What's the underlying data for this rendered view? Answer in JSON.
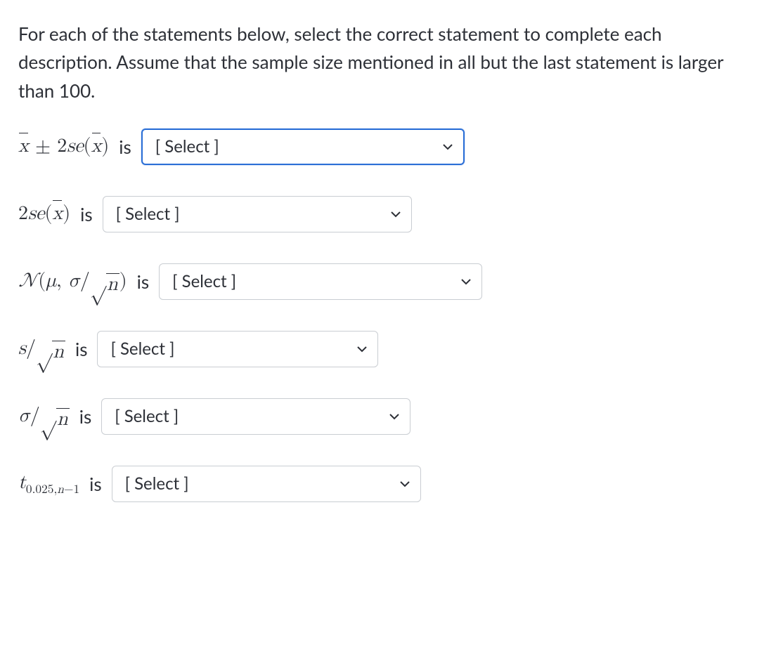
{
  "intro": "For each of the statements below, select the correct statement to complete each description. Assume that the sample size mentioned in all but the last statement is larger than 100.",
  "is_word": "is",
  "select_placeholder": "[ Select ]",
  "items": [
    {
      "focused": true,
      "width": "w460"
    },
    {
      "focused": false,
      "width": "w440"
    },
    {
      "focused": false,
      "width": "w460"
    },
    {
      "focused": false,
      "width": "w400"
    },
    {
      "focused": false,
      "width": "w440"
    },
    {
      "focused": false,
      "width": "w440"
    }
  ]
}
